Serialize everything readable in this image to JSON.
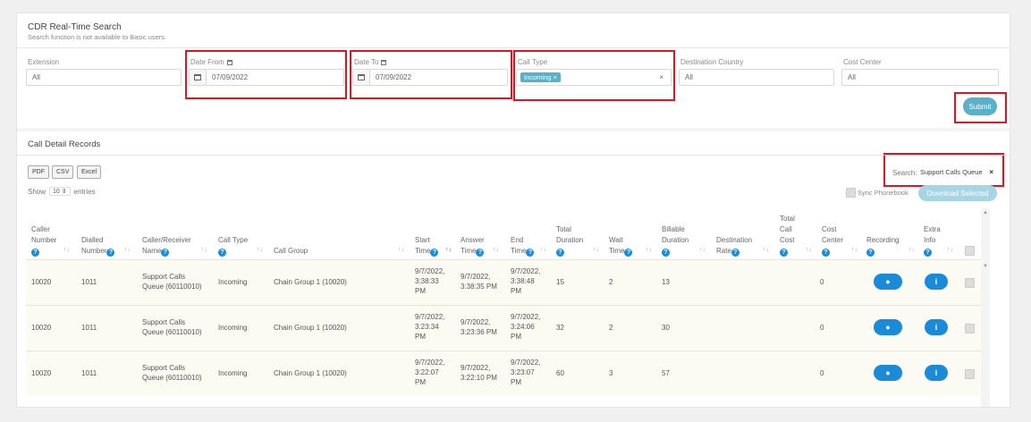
{
  "realtime": {
    "title": "CDR Real-Time Search",
    "subtitle": "Search function is not available to Basic users."
  },
  "filters": {
    "extension": {
      "label": "Extension",
      "value": "All"
    },
    "date_from": {
      "label": "Date From",
      "value": "07/09/2022"
    },
    "date_to": {
      "label": "Date To",
      "value": "07/09/2022"
    },
    "call_type": {
      "label": "Call Type",
      "chip": "Incoming",
      "chip_x": "×",
      "clear": "×"
    },
    "destination_country": {
      "label": "Destination Country",
      "value": "All"
    },
    "cost_center": {
      "label": "Cost Center",
      "value": "All"
    },
    "submit": "Submit"
  },
  "records": {
    "title": "Call Detail Records",
    "export": [
      "PDF",
      "CSV",
      "Excel"
    ],
    "show_prefix": "Show",
    "show_value": "10",
    "show_suffix": "entries",
    "search_label": "Search:",
    "search_value": "Support Calls Queue",
    "search_clear": "×",
    "sync_label": "Sync Phonebook",
    "download": "Download Selected",
    "columns": [
      {
        "l1": "Caller",
        "l2": "Number",
        "l3": ""
      },
      {
        "l1": "",
        "l2": "Dialled",
        "l3": "Number"
      },
      {
        "l1": "",
        "l2": "Caller/Receiver",
        "l3": "Name"
      },
      {
        "l1": "",
        "l2": "Call Type",
        "l3": ""
      },
      {
        "l1": "",
        "l2": "",
        "l3": "Call Group"
      },
      {
        "l1": "",
        "l2": "Start",
        "l3": "Time"
      },
      {
        "l1": "",
        "l2": "Answer",
        "l3": "Time"
      },
      {
        "l1": "",
        "l2": "End",
        "l3": "Time"
      },
      {
        "l1": "Total",
        "l2": "Duration",
        "l3": ""
      },
      {
        "l1": "",
        "l2": "Wait",
        "l3": "Time"
      },
      {
        "l1": "Billable",
        "l2": "Duration",
        "l3": ""
      },
      {
        "l1": "",
        "l2": "Destination",
        "l3": "Rate"
      },
      {
        "l1": "Total",
        "l2": "Call",
        "l3": "Cost"
      },
      {
        "l1": "Cost",
        "l2": "Center",
        "l3": ""
      },
      {
        "l1": "",
        "l2": "Recording",
        "l3": ""
      },
      {
        "l1": "Extra",
        "l2": "Info",
        "l3": ""
      }
    ],
    "rows": [
      {
        "caller": "10020",
        "dialled": "1011",
        "name1": "Support Calls",
        "name2": "Queue (60110010)",
        "type": "Incoming",
        "group": "Chain Group 1 (10020)",
        "start1": "9/7/2022,",
        "start2": "3:38:33",
        "start3": "PM",
        "answer1": "9/7/2022,",
        "answer2": "3:38:35 PM",
        "end1": "9/7/2022,",
        "end2": "3:38:48",
        "end3": "PM",
        "duration": "15",
        "wait": "2",
        "billable": "13",
        "rate": "",
        "cost": "",
        "center": "0"
      },
      {
        "caller": "10020",
        "dialled": "1011",
        "name1": "Support Calls",
        "name2": "Queue (60110010)",
        "type": "Incoming",
        "group": "Chain Group 1 (10020)",
        "start1": "9/7/2022,",
        "start2": "3:23:34",
        "start3": "PM",
        "answer1": "9/7/2022,",
        "answer2": "3:23:36 PM",
        "end1": "9/7/2022,",
        "end2": "3:24:06",
        "end3": "PM",
        "duration": "32",
        "wait": "2",
        "billable": "30",
        "rate": "",
        "cost": "",
        "center": "0"
      },
      {
        "caller": "10020",
        "dialled": "1011",
        "name1": "Support Calls",
        "name2": "Queue (60110010)",
        "type": "Incoming",
        "group": "Chain Group 1 (10020)",
        "start1": "9/7/2022,",
        "start2": "3:22:07",
        "start3": "PM",
        "answer1": "9/7/2022,",
        "answer2": "3:22:10 PM",
        "end1": "9/7/2022,",
        "end2": "3:23:07",
        "end3": "PM",
        "duration": "60",
        "wait": "3",
        "billable": "57",
        "rate": "",
        "cost": "",
        "center": "0"
      }
    ]
  },
  "icons": {
    "calendar": "calendar-icon",
    "help": "question-circle-icon",
    "recording": "microphone-icon",
    "info": "info-icon",
    "sort": "sort-arrows-icon"
  },
  "colors": {
    "accent": "#5bb0c8",
    "primary_pill": "#1a8bd8",
    "highlight": "#e0141e",
    "row_bg": "#fcfbf3"
  }
}
